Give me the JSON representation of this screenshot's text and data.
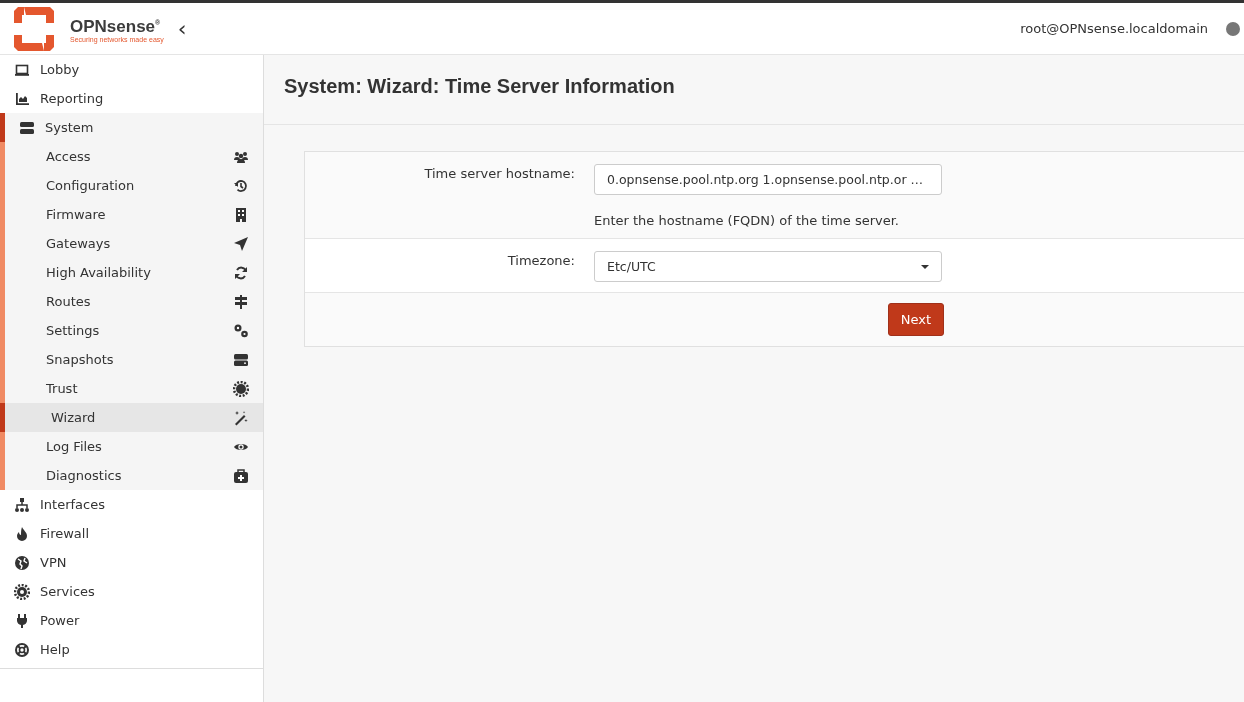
{
  "brand": {
    "name": "OPNsense",
    "registered": "®",
    "tagline": "Securing networks made easy"
  },
  "collapse_toggle": "‹",
  "user": "root@OPNsense.localdomain",
  "menu": [
    {
      "label": "Lobby",
      "selected": false,
      "expanded": false
    },
    {
      "label": "Reporting",
      "selected": false,
      "expanded": false
    },
    {
      "label": "System",
      "selected": false,
      "expanded": true,
      "children": [
        {
          "label": "Access",
          "selected": false
        },
        {
          "label": "Configuration",
          "selected": false
        },
        {
          "label": "Firmware",
          "selected": false
        },
        {
          "label": "Gateways",
          "selected": false
        },
        {
          "label": "High Availability",
          "selected": false
        },
        {
          "label": "Routes",
          "selected": false
        },
        {
          "label": "Settings",
          "selected": false
        },
        {
          "label": "Snapshots",
          "selected": false
        },
        {
          "label": "Trust",
          "selected": false
        },
        {
          "label": "Wizard",
          "selected": true
        },
        {
          "label": "Log Files",
          "selected": false
        },
        {
          "label": "Diagnostics",
          "selected": false
        }
      ]
    },
    {
      "label": "Interfaces",
      "selected": false,
      "expanded": false
    },
    {
      "label": "Firewall",
      "selected": false,
      "expanded": false
    },
    {
      "label": "VPN",
      "selected": false,
      "expanded": false
    },
    {
      "label": "Services",
      "selected": false,
      "expanded": false
    },
    {
      "label": "Power",
      "selected": false,
      "expanded": false
    },
    {
      "label": "Help",
      "selected": false,
      "expanded": false
    }
  ],
  "page_title": "System: Wizard: Time Server Information",
  "form": {
    "rows": [
      {
        "kind": "text",
        "label": "Time server hostname:",
        "value": "0.opnsense.pool.ntp.org 1.opnsense.pool.ntp.or …",
        "help": "Enter the hostname (FQDN) of the time server."
      },
      {
        "kind": "select",
        "label": "Timezone:",
        "value": "Etc/UTC"
      }
    ],
    "button": "Next"
  }
}
